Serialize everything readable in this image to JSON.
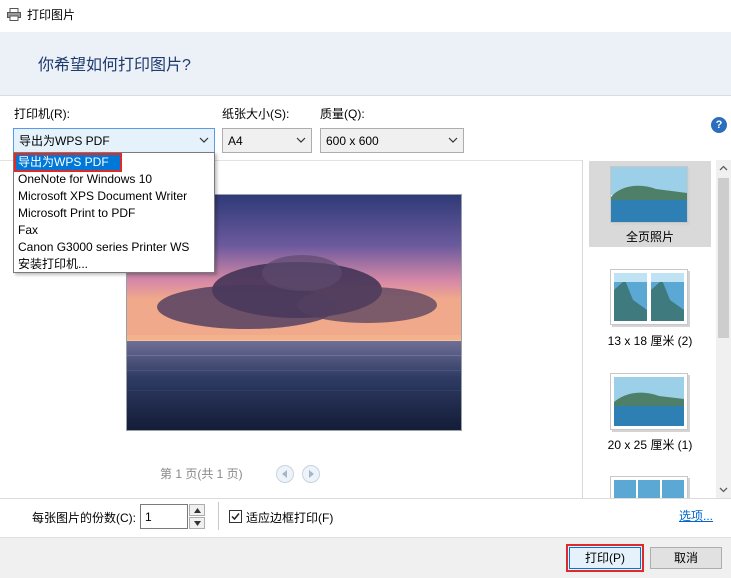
{
  "window": {
    "title": "打印图片"
  },
  "header": {
    "question": "你希望如何打印图片?"
  },
  "printer": {
    "label": "打印机(R):",
    "selected": "导出为WPS PDF",
    "options": [
      "导出为WPS PDF",
      "OneNote for Windows 10",
      "Microsoft XPS Document Writer",
      "Microsoft Print to PDF",
      "Fax",
      "Canon G3000 series Printer WS",
      "安装打印机..."
    ]
  },
  "paper_size": {
    "label": "纸张大小(S):",
    "selected": "A4"
  },
  "quality": {
    "label": "质量(Q):",
    "selected": "600 x 600"
  },
  "help": {
    "glyph": "?"
  },
  "pager": {
    "text": "第 1 页(共 1 页)"
  },
  "layouts": [
    {
      "label": "全页照片",
      "selected": true
    },
    {
      "label": "13 x 18 厘米 (2)",
      "selected": false
    },
    {
      "label": "20 x 25 厘米 (1)",
      "selected": false
    }
  ],
  "copies": {
    "label": "每张图片的份数(C):",
    "value": "1"
  },
  "fit_to_frame": {
    "label": "适应边框打印(F)",
    "checked": true
  },
  "options_link": "选项...",
  "buttons": {
    "print": "打印(P)",
    "cancel": "取消"
  },
  "colors": {
    "accent": "#0078d7",
    "highlight_outline": "#e02a2a",
    "header_bg": "#ecf1f8"
  }
}
